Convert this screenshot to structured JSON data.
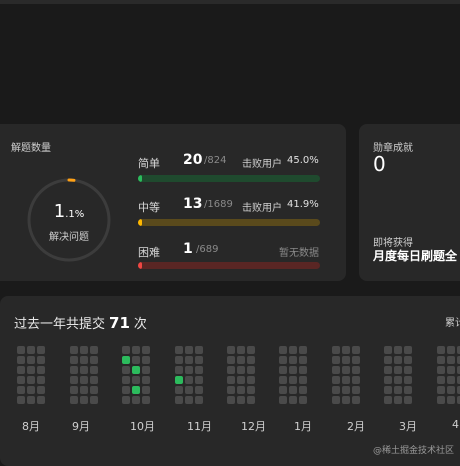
{
  "solved": {
    "title": "解题数量",
    "ring_value": "1",
    "ring_decimal": ".1%",
    "ring_label": "解决问题",
    "ring_fraction": 0.011,
    "rows": [
      {
        "name": "简单",
        "count": "20",
        "total": "/824",
        "beat_label": "击败用户",
        "beat_pct": "45.0%",
        "fill": 0.024,
        "color": "#2cbb5d",
        "track": "#1f4a2e"
      },
      {
        "name": "中等",
        "count": "13",
        "total": "/1689",
        "beat_label": "击败用户",
        "beat_pct": "41.9%",
        "fill": 0.008,
        "color": "#ffb800",
        "track": "#5a4a1c"
      },
      {
        "name": "困难",
        "count": "1",
        "total": "/689",
        "beat_label": "暂无数据",
        "beat_pct": "",
        "fill": 0.0015,
        "color": "#ef4743",
        "track": "#5a2624"
      }
    ]
  },
  "badges": {
    "title": "勋章成就",
    "count": "0",
    "next_label": "即将获得",
    "next_name": "月度每日刷题全"
  },
  "heatmap": {
    "title": "过去一年共提交",
    "count": "71",
    "unit": "次",
    "right_label": "累计",
    "months": [
      "8月",
      "9月",
      "10月",
      "11月",
      "12月",
      "1月",
      "2月",
      "3月",
      "4"
    ],
    "active_cells": [
      [
        6,
        1
      ],
      [
        7,
        2
      ],
      [
        7,
        4
      ],
      [
        9,
        3
      ]
    ]
  },
  "watermark": "@稀土掘金技术社区",
  "colors": {
    "bg": "#1a1a1a",
    "card": "#282828",
    "cell": "#4a4a4a",
    "active": "#2cbb5d",
    "ring_track": "#3c3c3c",
    "ring_accent": "#ffa116"
  }
}
